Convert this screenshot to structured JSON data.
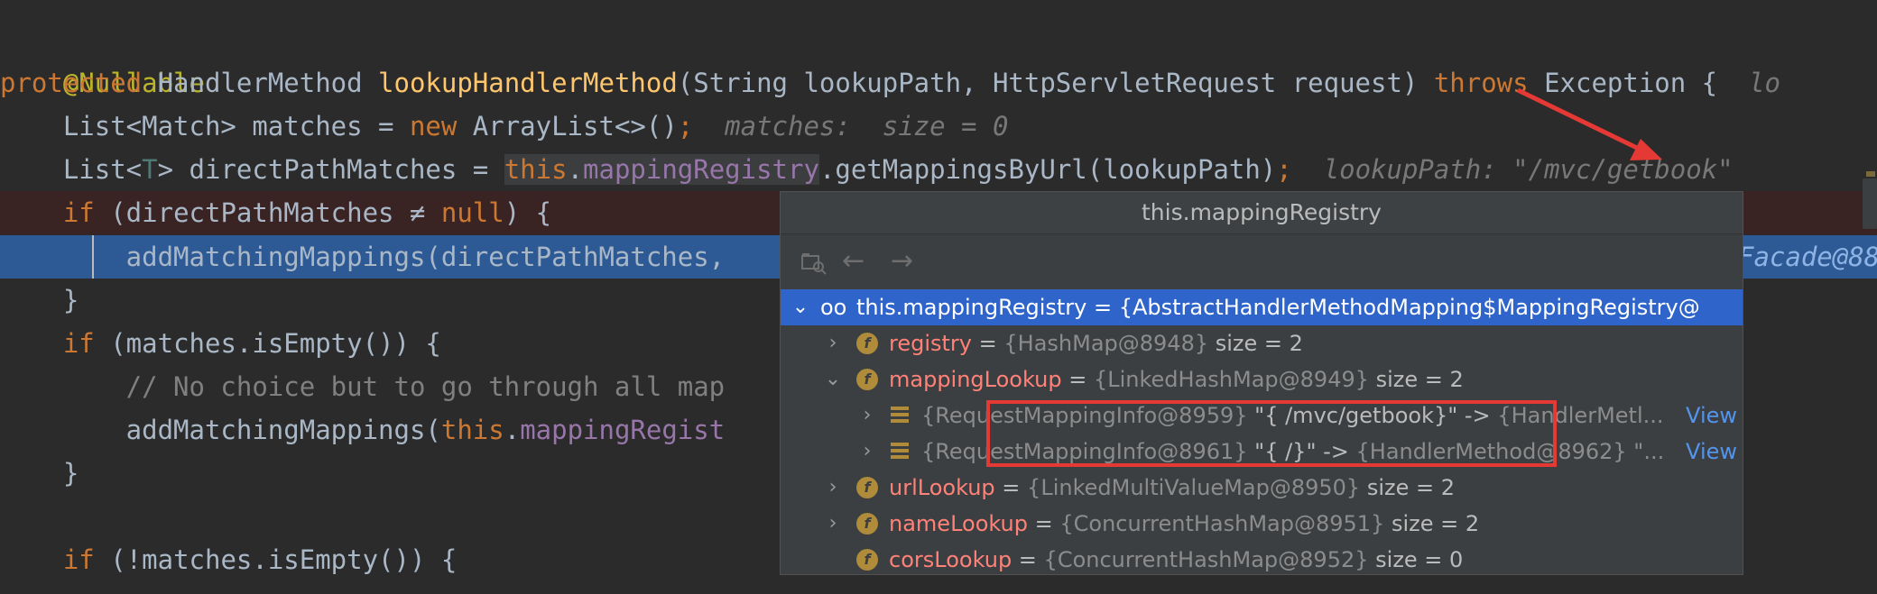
{
  "code": {
    "annotation": "@Nullable",
    "l2": {
      "kw_protected": "protected",
      "type": " HandlerMethod ",
      "method": "lookupHandlerMethod",
      "params": "(String lookupPath, HttpServletRequest request) ",
      "kw_throws": "throws",
      "rest": " Exception {",
      "hint": "  lo"
    },
    "l3": {
      "a": "    List<Match> matches = ",
      "kw_new": "new",
      "b": " ArrayList<>()",
      "semi": ";",
      "hint": "  matches:  size = 0"
    },
    "l4": {
      "a": "    List<",
      "gen": "T",
      "b": "> directPathMatches = ",
      "kw_this": "this",
      "dot": ".",
      "field": "mappingRegistry",
      "c": ".getMappingsByUrl(lookupPath)",
      "semi": ";",
      "hint": "  lookupPath: \"/mvc/getbook\""
    },
    "l5": {
      "indent": "    ",
      "kw_if": "if",
      "a": " (directPathMatches ≠ ",
      "kw_null": "null",
      "b": ") {"
    },
    "l6": {
      "a": "        addMatchingMappings(directPathMatches,",
      "hint": "Facade@88"
    },
    "l7": "    }",
    "l8": {
      "indent": "    ",
      "kw_if": "if",
      "a": " (matches.isEmpty()) {"
    },
    "l9": "        // No choice but to go through all map",
    "l10": {
      "a": "        addMatchingMappings(",
      "kw_this": "this",
      "dot": ".",
      "field": "mappingRegist"
    },
    "l11": "    }",
    "l13": {
      "indent": "    ",
      "kw_if": "if",
      "a": " (!matches.isEmpty()) {"
    }
  },
  "popup": {
    "title": "this.mappingRegistry",
    "toolbar": {
      "back": "←",
      "forward": "→"
    },
    "root": {
      "name": "this.mappingRegistry",
      "value": " = {AbstractHandlerMethodMapping$MappingRegistry@"
    },
    "fields": [
      {
        "name": "registry",
        "eq": " = ",
        "type": "{HashMap@8948}",
        "size": "  size = 2",
        "expanded": false
      },
      {
        "name": "mappingLookup",
        "eq": " = ",
        "type": "{LinkedHashMap@8949}",
        "size": "  size = 2",
        "expanded": true
      }
    ],
    "entries": [
      {
        "type": "{RequestMappingInfo@8959}",
        "value": " \"{ /mvc/getbook}\" -> ",
        "target": "{HandlerMetl",
        "ellipsis": "...",
        "view": "View"
      },
      {
        "type": "{RequestMappingInfo@8961}",
        "value": " \"{ /}\" -> ",
        "target": "{HandlerMethod@8962} \"",
        "ellipsis": "...",
        "view": "View"
      }
    ],
    "fields2": [
      {
        "name": "urlLookup",
        "eq": " = ",
        "type": "{LinkedMultiValueMap@8950}",
        "size": "  size = 2"
      },
      {
        "name": "nameLookup",
        "eq": " = ",
        "type": "{ConcurrentHashMap@8951}",
        "size": "  size = 2"
      },
      {
        "name": "corsLookup",
        "eq": " = ",
        "type": "{ConcurrentHashMap@8952}",
        "size": "  size = 0"
      }
    ],
    "field_icon_letter": "f"
  },
  "colors": {
    "keyword": "#cc7832",
    "method": "#ffc66d",
    "field": "#9876aa",
    "selection": "#2f65ca",
    "highlight_box": "#e53935"
  }
}
